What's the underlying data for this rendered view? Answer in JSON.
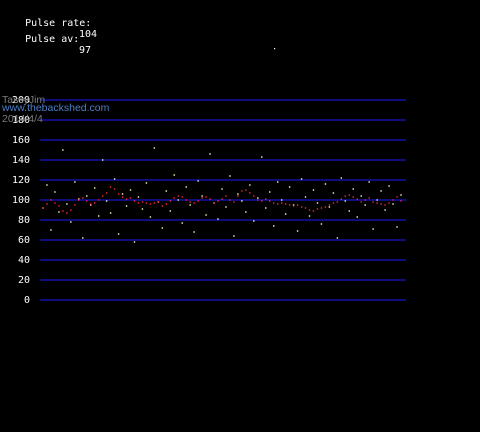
{
  "readouts": {
    "pulse_rate_label": "Pulse rate:",
    "pulse_rate_value": "104",
    "pulse_av_label": "Pulse av:",
    "pulse_av_value": "97"
  },
  "watermark": {
    "line1": "TassyJim",
    "line2": "www.thebackshed.com",
    "line3": "2014/4/4"
  },
  "chart_data": {
    "type": "scatter",
    "title": "",
    "xlabel": "",
    "ylabel": "",
    "ylim": [
      0,
      200
    ],
    "yticks": [
      200,
      180,
      160,
      140,
      120,
      100,
      80,
      60,
      40,
      20,
      0
    ],
    "grid": true,
    "colors": {
      "background": "#000000",
      "grid": "#1a1aff",
      "pulse_rate_points": "#ffffc8",
      "pulse_average_points": "#ff2a2a"
    },
    "series": [
      {
        "x": [
          0,
          4,
          8,
          12,
          16,
          20,
          24,
          28,
          32,
          36,
          40,
          44,
          48,
          52,
          56,
          60,
          64,
          68,
          72,
          76,
          80,
          84,
          88,
          92,
          96,
          100,
          104,
          108,
          112,
          116,
          120,
          124,
          128,
          132,
          136,
          140,
          144,
          148,
          152,
          156,
          160,
          164,
          168,
          172,
          176,
          180,
          184,
          188,
          192,
          196,
          200,
          204,
          208,
          212,
          216,
          220,
          224,
          228,
          232,
          236,
          240,
          244,
          248,
          252,
          256,
          260,
          264,
          268,
          272,
          276,
          280,
          284,
          288,
          292,
          296,
          300,
          304,
          308,
          312,
          316,
          320,
          324,
          328,
          332,
          336,
          340,
          344,
          348,
          352,
          356,
          360
        ],
        "values": [
          92,
          115,
          70,
          108,
          88,
          150,
          96,
          78,
          118,
          101,
          62,
          104,
          95,
          112,
          84,
          140,
          99,
          87,
          121,
          66,
          106,
          94,
          110,
          58,
          103,
          91,
          117,
          83,
          152,
          98,
          72,
          109,
          89,
          125,
          100,
          77,
          113,
          95,
          68,
          119,
          104,
          85,
          146,
          97,
          81,
          111,
          93,
          124,
          64,
          106,
          99,
          88,
          115,
          79,
          102,
          143,
          92,
          108,
          74,
          118,
          100,
          86,
          113,
          95,
          69,
          121,
          103,
          84,
          110,
          97,
          76,
          116,
          93,
          107,
          62,
          122,
          99,
          89,
          111,
          83,
          104,
          95,
          118,
          71,
          100,
          109,
          90,
          114,
          96,
          73,
          105
        ]
      },
      {
        "x": [
          0,
          4,
          8,
          12,
          16,
          20,
          24,
          28,
          32,
          36,
          40,
          44,
          48,
          52,
          56,
          60,
          64,
          68,
          72,
          76,
          80,
          84,
          88,
          92,
          96,
          100,
          104,
          108,
          112,
          116,
          120,
          124,
          128,
          132,
          136,
          140,
          144,
          148,
          152,
          156,
          160,
          164,
          168,
          172,
          176,
          180,
          184,
          188,
          192,
          196,
          200,
          204,
          208,
          212,
          216,
          220,
          224,
          228,
          232,
          236,
          240,
          244,
          248,
          252,
          256,
          260,
          264,
          268,
          272,
          276,
          280,
          284,
          288,
          292,
          296,
          300,
          304,
          308,
          312,
          316,
          320,
          324,
          328,
          332,
          336,
          340,
          344,
          348,
          352,
          356,
          360
        ],
        "values": [
          92,
          96,
          100,
          97,
          94,
          89,
          87,
          90,
          95,
          100,
          102,
          99,
          96,
          97,
          100,
          104,
          107,
          113,
          111,
          106,
          103,
          101,
          102,
          99,
          97,
          98,
          97,
          96,
          97,
          98,
          94,
          96,
          99,
          102,
          104,
          103,
          100,
          98,
          97,
          99,
          102,
          103,
          101,
          97,
          99,
          101,
          104,
          100,
          98,
          104,
          109,
          110,
          107,
          104,
          100,
          99,
          101,
          99,
          97,
          96,
          97,
          96,
          95,
          94,
          95,
          93,
          92,
          90,
          89,
          91,
          92,
          93,
          95,
          97,
          98,
          101,
          104,
          105,
          103,
          101,
          98,
          100,
          102,
          98,
          97,
          96,
          95,
          97,
          100,
          103,
          99
        ]
      }
    ]
  }
}
